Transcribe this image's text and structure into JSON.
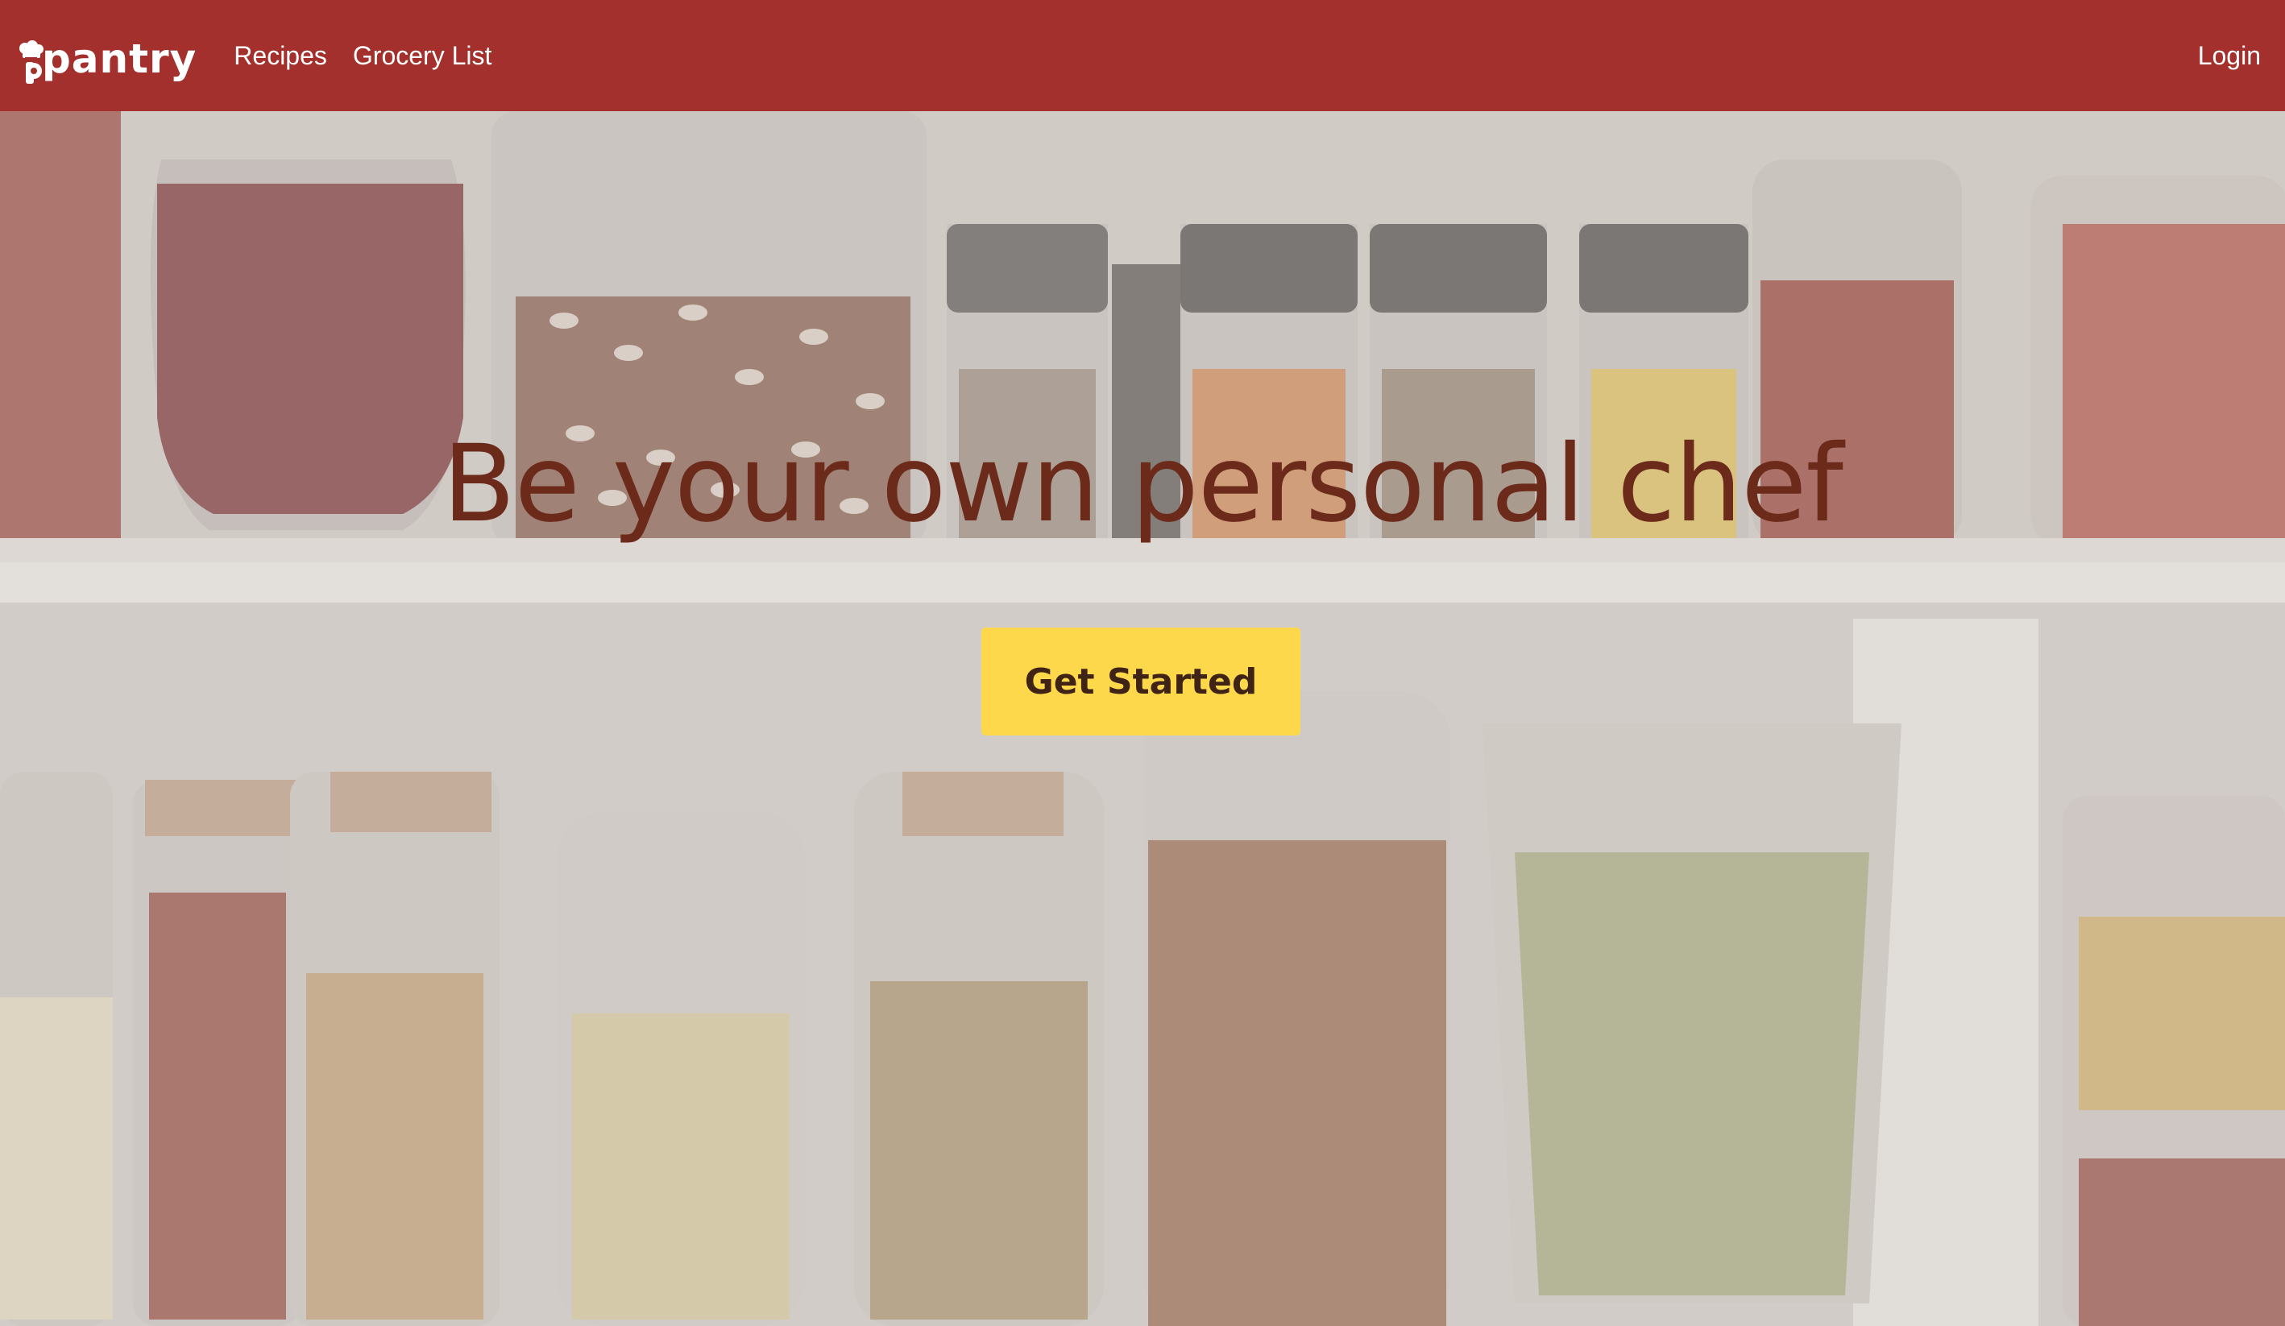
{
  "nav": {
    "brand": "pantry",
    "links": [
      "Recipes",
      "Grocery List"
    ],
    "login": "Login"
  },
  "hero": {
    "headline": "Be your own personal chef",
    "cta_label": "Get Started"
  },
  "colors": {
    "navbar": "#a3302c",
    "headline": "#6b2a1a",
    "cta_background": "#fdd84a",
    "cta_text": "#3f2415"
  }
}
